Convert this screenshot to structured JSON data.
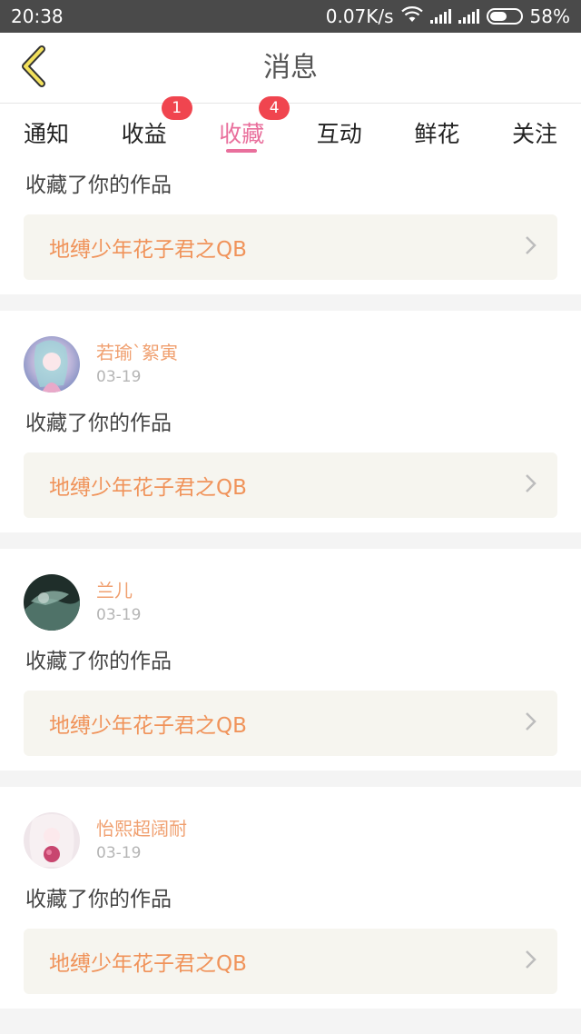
{
  "status_bar": {
    "time": "20:38",
    "speed": "0.07K/s",
    "battery": "58%",
    "battery_level": 0.58,
    "icons": [
      "wifi-icon",
      "signal-icon",
      "signal-icon",
      "battery-icon"
    ]
  },
  "header": {
    "title": "消息",
    "back_icon": "chevron-left-icon"
  },
  "tabs": [
    {
      "label": "通知",
      "badge": ""
    },
    {
      "label": "收益",
      "badge": "1"
    },
    {
      "label": "收藏",
      "badge": "4",
      "active": true
    },
    {
      "label": "互动",
      "badge": ""
    },
    {
      "label": "鲜花",
      "badge": ""
    },
    {
      "label": "关注",
      "badge": ""
    }
  ],
  "colors": {
    "accent": "#e96f9c",
    "badge": "#f0454f",
    "username": "#f0a070",
    "work_title": "#f0935a"
  },
  "items": [
    {
      "user": "",
      "date": "",
      "action": "收藏了你的作品",
      "work": "地缚少年花子君之QB"
    },
    {
      "user": "若瑜`絮寅",
      "date": "03-19",
      "action": "收藏了你的作品",
      "work": "地缚少年花子君之QB"
    },
    {
      "user": "兰儿",
      "date": "03-19",
      "action": "收藏了你的作品",
      "work": "地缚少年花子君之QB"
    },
    {
      "user": "怡熙超阔耐",
      "date": "03-19",
      "action": "收藏了你的作品",
      "work": "地缚少年花子君之QB"
    }
  ]
}
